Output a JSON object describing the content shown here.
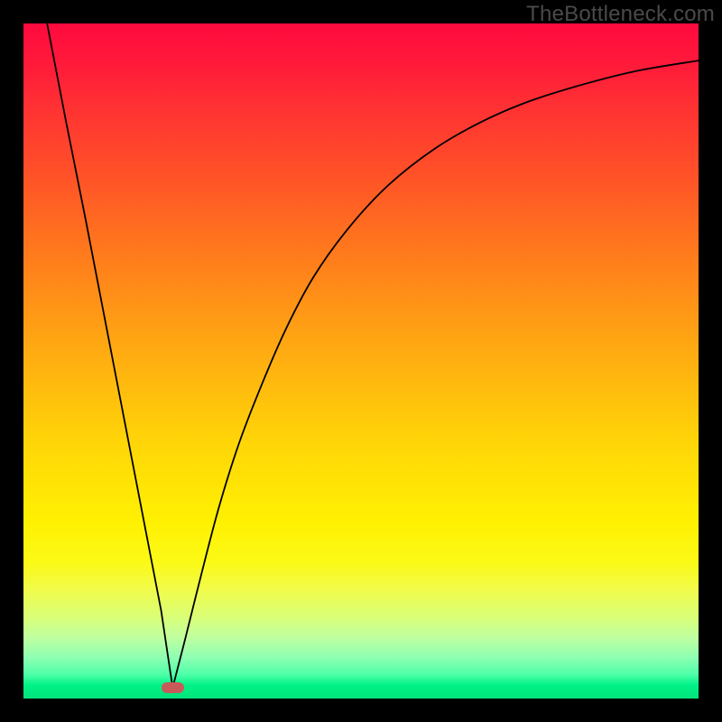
{
  "watermark": "TheBottleneck.com",
  "chart_data": {
    "type": "line",
    "title": "",
    "xlabel": "",
    "ylabel": "",
    "xlim": [
      0,
      100
    ],
    "ylim": [
      0,
      100
    ],
    "grid": false,
    "legend": false,
    "series": [
      {
        "name": "left-descent",
        "x": [
          3.5,
          6.3,
          9.2,
          12.0,
          14.8,
          17.6,
          20.4,
          22.1
        ],
        "values": [
          100,
          85.5,
          71.0,
          56.5,
          42.0,
          27.5,
          13.0,
          1.6
        ]
      },
      {
        "name": "right-curve",
        "x": [
          22.1,
          24.0,
          26.5,
          29.0,
          32.0,
          35.5,
          39.0,
          43.0,
          48.0,
          54.0,
          61.0,
          68.0,
          75.0,
          83.0,
          91.0,
          100.0
        ],
        "values": [
          1.6,
          9.0,
          19.0,
          28.5,
          38.0,
          47.0,
          55.0,
          62.5,
          69.5,
          76.0,
          81.5,
          85.5,
          88.5,
          91.0,
          93.0,
          94.5
        ]
      }
    ],
    "marker": {
      "name": "optimal-point",
      "x": 22.1,
      "y": 1.6,
      "width_pct": 3.4,
      "height_pct": 1.7,
      "color": "#c85a5a"
    },
    "gradient_stops": [
      {
        "pct": 0,
        "color": "#ff0a3e"
      },
      {
        "pct": 48,
        "color": "#ffa912"
      },
      {
        "pct": 74,
        "color": "#fff102"
      },
      {
        "pct": 100,
        "color": "#00e47a"
      }
    ]
  }
}
